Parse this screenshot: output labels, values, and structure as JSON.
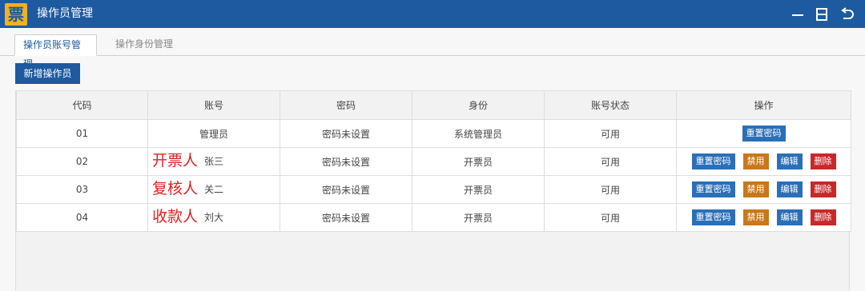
{
  "window": {
    "logo_char": "票",
    "title": "操作员管理"
  },
  "tabs": [
    {
      "label": "操作员账号管理",
      "active": true
    },
    {
      "label": "操作身份管理",
      "active": false
    }
  ],
  "toolbar": {
    "add_label": "新增操作员"
  },
  "table": {
    "headers": [
      "代码",
      "账号",
      "密码",
      "身份",
      "账号状态",
      "操作"
    ],
    "rows": [
      {
        "code": "01",
        "note": "",
        "account": "管理员",
        "password": "密码未设置",
        "role": "系统管理员",
        "status": "可用",
        "actions": [
          "重置密码"
        ]
      },
      {
        "code": "02",
        "note": "开票人",
        "account": "张三",
        "password": "密码未设置",
        "role": "开票员",
        "status": "可用",
        "actions": [
          "重置密码",
          "禁用",
          "编辑",
          "删除"
        ]
      },
      {
        "code": "03",
        "note": "复核人",
        "account": "关二",
        "password": "密码未设置",
        "role": "开票员",
        "status": "可用",
        "actions": [
          "重置密码",
          "禁用",
          "编辑",
          "删除"
        ]
      },
      {
        "code": "04",
        "note": "收款人",
        "account": "刘大",
        "password": "密码未设置",
        "role": "开票员",
        "status": "可用",
        "actions": [
          "重置密码",
          "禁用",
          "编辑",
          "删除"
        ]
      }
    ]
  },
  "colors": {
    "brand": "#1d5aa0",
    "logo": "#f2b21a",
    "note_red": "#e02020",
    "disable": "#c8781a",
    "delete": "#c8282a"
  }
}
